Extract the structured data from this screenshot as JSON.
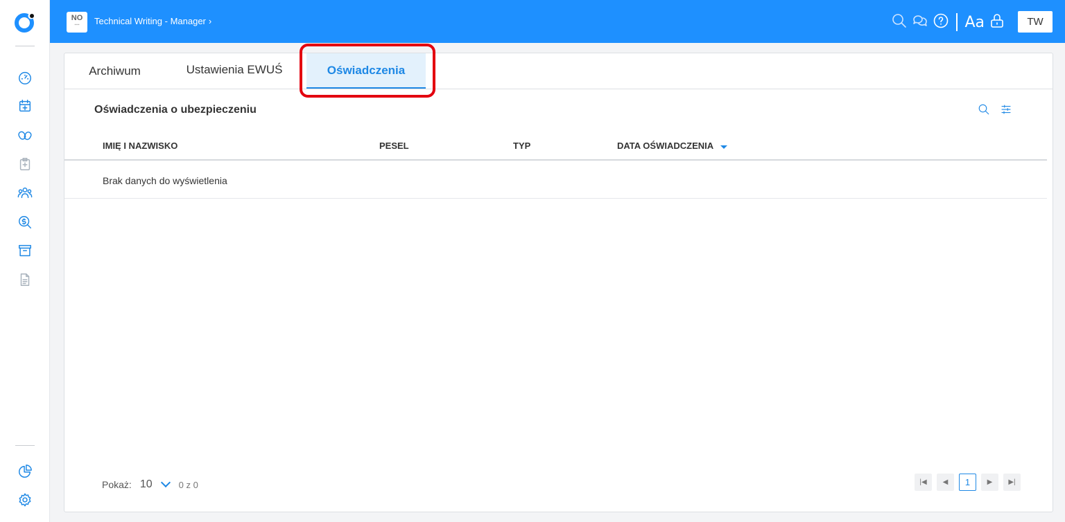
{
  "header": {
    "org_badge": "NO",
    "breadcrumb": "Technical Writing - Manager",
    "font_size_label": "Aa",
    "user_initials": "TW"
  },
  "sidebar": {
    "top_icons": [
      "dashboard-icon",
      "calendar-plus-icon",
      "pills-icon",
      "clipboard-medical-icon",
      "people-icon",
      "money-search-icon",
      "archive-icon",
      "document-icon"
    ],
    "bottom_icons": [
      "pie-chart-icon",
      "settings-icon"
    ]
  },
  "tabs": [
    {
      "label": "Archiwum",
      "active": false
    },
    {
      "label": "Ustawienia EWUŚ",
      "active": false
    },
    {
      "label": "Oświadczenia",
      "active": true
    }
  ],
  "main": {
    "section_title": "Oświadczenia o ubezpieczeniu",
    "columns": [
      "IMIĘ I NAZWISKO",
      "PESEL",
      "TYP",
      "DATA OŚWIADCZENIA"
    ],
    "empty_message": "Brak danych do wyświetlenia"
  },
  "pagination": {
    "show_label": "Pokaż:",
    "page_size": "10",
    "range": "0 z 0",
    "current_page": "1"
  },
  "colors": {
    "accent": "#1e90ff",
    "highlight": "#e3000f"
  }
}
